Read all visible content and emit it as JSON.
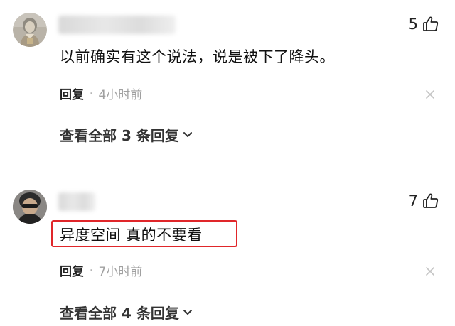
{
  "comments": [
    {
      "likes": "5",
      "text": "以前确实有这个说法，说是被下了降头。",
      "reply_label": "回复",
      "separator": "·",
      "time": "4小时前",
      "view_replies": "查看全部 3 条回复",
      "highlighted": false
    },
    {
      "likes": "7",
      "text": "异度空间 真的不要看",
      "reply_label": "回复",
      "separator": "·",
      "time": "7小时前",
      "view_replies": "查看全部 4 条回复",
      "highlighted": true
    }
  ],
  "colors": {
    "highlight": "#e0262a",
    "muted_text": "#a0a0a0"
  },
  "icons": [
    "thumbs-up-icon",
    "close-icon",
    "chevron-down-icon"
  ]
}
